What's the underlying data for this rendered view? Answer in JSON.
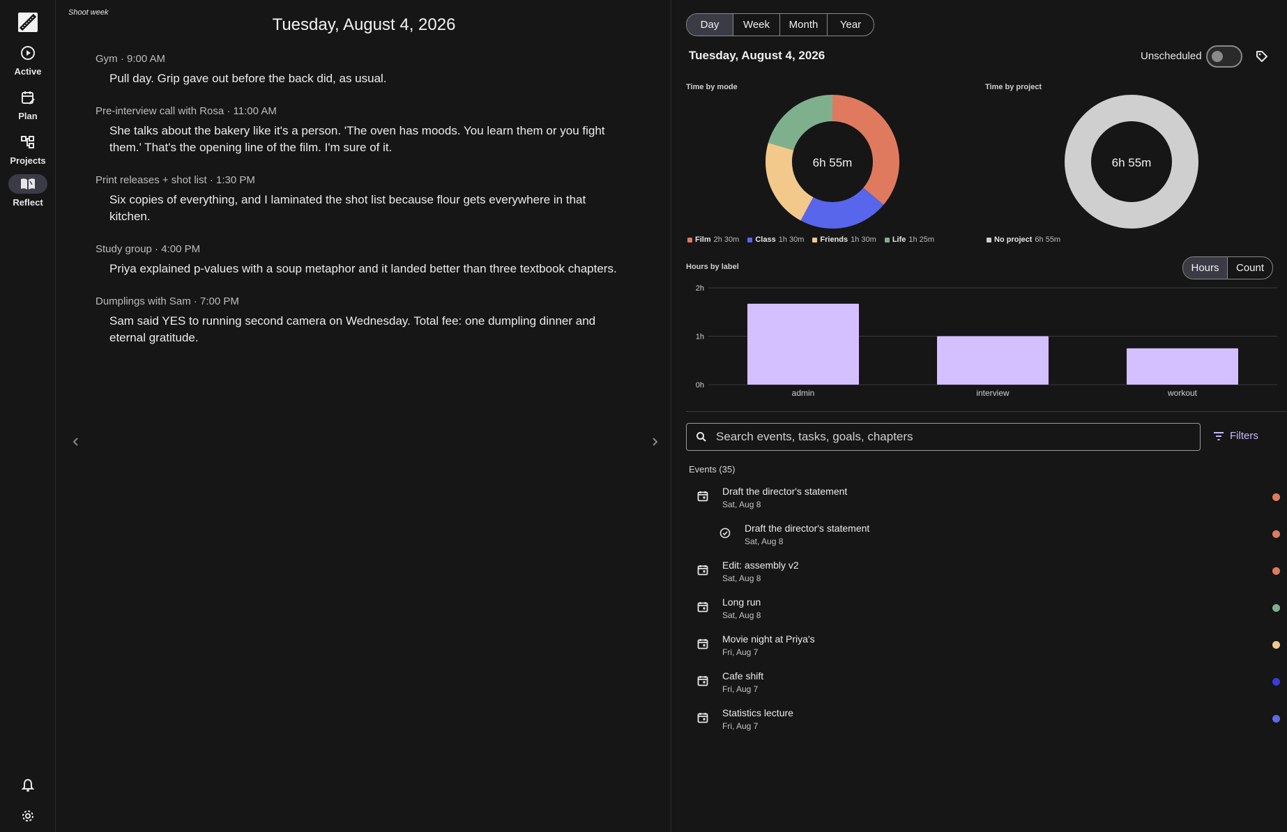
{
  "nav": {
    "items": [
      {
        "label": "Active",
        "icon": "play-circle-icon"
      },
      {
        "label": "Plan",
        "icon": "calendar-edit-icon"
      },
      {
        "label": "Projects",
        "icon": "hierarchy-icon"
      },
      {
        "label": "Reflect",
        "icon": "open-book-icon"
      }
    ]
  },
  "journal": {
    "week_tag": "Shoot week",
    "date": "Tuesday, August 4, 2026",
    "entries": [
      {
        "head": "Gym · 9:00 AM",
        "body": "Pull day. Grip gave out before the back did, as usual."
      },
      {
        "head": "Pre-interview call with Rosa · 11:00 AM",
        "body": "She talks about the bakery like it's a person. 'The oven has moods. You learn them or you fight them.' That's the opening line of the film. I'm sure of it."
      },
      {
        "head": "Print releases + shot list · 1:30 PM",
        "body": "Six copies of everything, and I laminated the shot list because flour gets everywhere in that kitchen."
      },
      {
        "head": "Study group · 4:00 PM",
        "body": "Priya explained p-values with a soup metaphor and it landed better than three textbook chapters."
      },
      {
        "head": "Dumplings with Sam · 7:00 PM",
        "body": "Sam said YES to running second camera on Wednesday. Total fee: one dumpling dinner and eternal gratitude."
      }
    ]
  },
  "dashboard": {
    "range_tabs": [
      "Day",
      "Week",
      "Month",
      "Year"
    ],
    "selected_range": "Day",
    "date": "Tuesday, August 4, 2026",
    "unscheduled_label": "Unscheduled",
    "unscheduled_on": false,
    "mode_title": "Time by mode",
    "mode_total": "6h 55m",
    "project_title": "Time by project",
    "project_total": "6h 55m",
    "hours_title": "Hours by label",
    "metric_tabs": [
      "Hours",
      "Count"
    ],
    "selected_metric": "Hours",
    "search_placeholder": "Search events, tasks, goals, chapters",
    "filters_label": "Filters",
    "events_title": "Events (35)",
    "events": [
      {
        "name": "Draft the director's statement",
        "date": "Sat, Aug 8",
        "kind": "calendar-icon",
        "color": "#e07a5f",
        "sub": false
      },
      {
        "name": "Draft the director's statement",
        "date": "Sat, Aug 8",
        "kind": "check-circle-icon",
        "color": "#e07a5f",
        "sub": true
      },
      {
        "name": "Edit: assembly v2",
        "date": "Sat, Aug 8",
        "kind": "calendar-icon",
        "color": "#e07a5f",
        "sub": false
      },
      {
        "name": "Long run",
        "date": "Sat, Aug 8",
        "kind": "calendar-icon",
        "color": "#7fb08e",
        "sub": false
      },
      {
        "name": "Movie night at Priya's",
        "date": "Fri, Aug 7",
        "kind": "calendar-icon",
        "color": "#f2c98a",
        "sub": false
      },
      {
        "name": "Cafe shift",
        "date": "Fri, Aug 7",
        "kind": "calendar-icon",
        "color": "#3b3bdd",
        "sub": false
      },
      {
        "name": "Statistics lecture",
        "date": "Fri, Aug 7",
        "kind": "calendar-icon",
        "color": "#5a6be8",
        "sub": false
      }
    ]
  },
  "chart_data": [
    {
      "type": "pie",
      "title": "Time by mode",
      "center_label": "6h 55m",
      "categories": [
        "Film",
        "Class",
        "Friends",
        "Life"
      ],
      "values": [
        150,
        90,
        90,
        85
      ],
      "value_labels": [
        "2h 30m",
        "1h 30m",
        "1h 30m",
        "1h 25m"
      ],
      "colors": [
        "#e07a5f",
        "#5766ea",
        "#f2c98a",
        "#7fb08e"
      ]
    },
    {
      "type": "pie",
      "title": "Time by project",
      "center_label": "6h 55m",
      "categories": [
        "No project"
      ],
      "values": [
        415
      ],
      "value_labels": [
        "6h 55m"
      ],
      "colors": [
        "#cfcfcf"
      ]
    },
    {
      "type": "bar",
      "title": "Hours by label",
      "categories": [
        "admin",
        "interview",
        "workout"
      ],
      "values": [
        1.67,
        1.0,
        0.75
      ],
      "y_ticks": [
        "0h",
        "1h",
        "2h"
      ],
      "ylim": [
        0,
        2
      ],
      "color": "#d4bfff",
      "grid": true
    }
  ]
}
